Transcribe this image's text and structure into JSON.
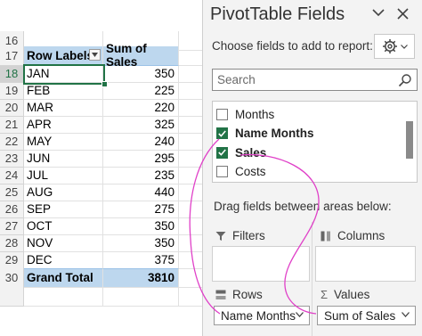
{
  "sheet": {
    "top_row_number": "16",
    "header": {
      "row_number": "17",
      "col_a": "Row Labels",
      "col_b": "Sum of Sales"
    },
    "rows": [
      {
        "row_number": "18",
        "label": "JAN",
        "value": "350"
      },
      {
        "row_number": "19",
        "label": "FEB",
        "value": "225"
      },
      {
        "row_number": "20",
        "label": "MAR",
        "value": "220"
      },
      {
        "row_number": "21",
        "label": "APR",
        "value": "325"
      },
      {
        "row_number": "22",
        "label": "MAY",
        "value": "240"
      },
      {
        "row_number": "23",
        "label": "JUN",
        "value": "295"
      },
      {
        "row_number": "24",
        "label": "JUL",
        "value": "235"
      },
      {
        "row_number": "25",
        "label": "AUG",
        "value": "440"
      },
      {
        "row_number": "26",
        "label": "SEP",
        "value": "275"
      },
      {
        "row_number": "27",
        "label": "OCT",
        "value": "350"
      },
      {
        "row_number": "28",
        "label": "NOV",
        "value": "350"
      },
      {
        "row_number": "29",
        "label": "DEC",
        "value": "375"
      }
    ],
    "total": {
      "row_number": "30",
      "label": "Grand Total",
      "value": "3810"
    },
    "selected_row_number": "18",
    "header_fill": "#bdd7ee",
    "selection_color": "#217346"
  },
  "pane": {
    "title": "PivotTable Fields",
    "choose_label": "Choose fields to add to report:",
    "search_placeholder": "Search",
    "fields": [
      {
        "label": "Months",
        "checked": false
      },
      {
        "label": "Name Months",
        "checked": true
      },
      {
        "label": "Sales",
        "checked": true
      },
      {
        "label": "Costs",
        "checked": false
      }
    ],
    "drag_label": "Drag fields between areas below:",
    "areas": {
      "filters": "Filters",
      "columns": "Columns",
      "rows": "Rows",
      "values": "Values"
    },
    "rows_pill": "Name Months",
    "values_pill": "Sum of Sales",
    "annotation_color": "#e040c8",
    "checkbox_color": "#217346"
  }
}
